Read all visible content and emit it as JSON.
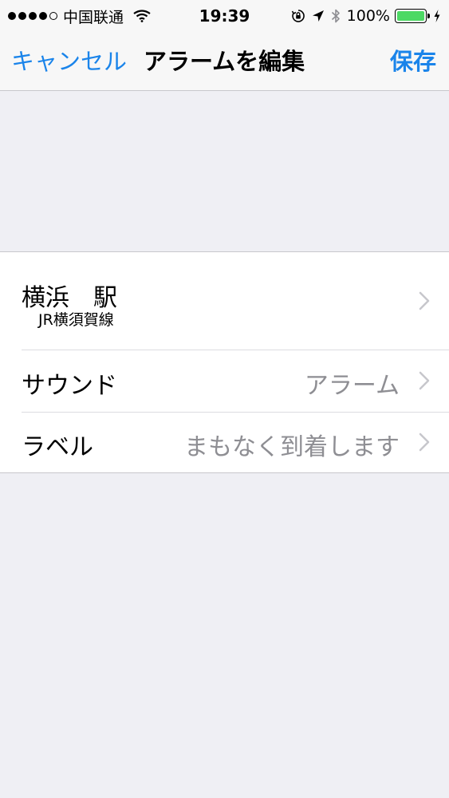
{
  "status_bar": {
    "carrier": "中国联通",
    "time": "19:39",
    "battery_percent": "100%",
    "battery_level": 1.0,
    "signal_bars_filled": 4,
    "signal_bars_total": 5
  },
  "nav": {
    "cancel_label": "キャンセル",
    "title": "アラームを編集",
    "save_label": "保存"
  },
  "settings": {
    "station": {
      "name": "横浜　駅",
      "line": "JR横須賀線"
    },
    "sound": {
      "title": "サウンド",
      "value": "アラーム"
    },
    "label": {
      "title": "ラベル",
      "value": "まもなく到着します"
    }
  },
  "colors": {
    "accent": "#1a84ea",
    "background": "#efeff4",
    "secondary_text": "#8e8e93",
    "battery": "#4cd964"
  }
}
